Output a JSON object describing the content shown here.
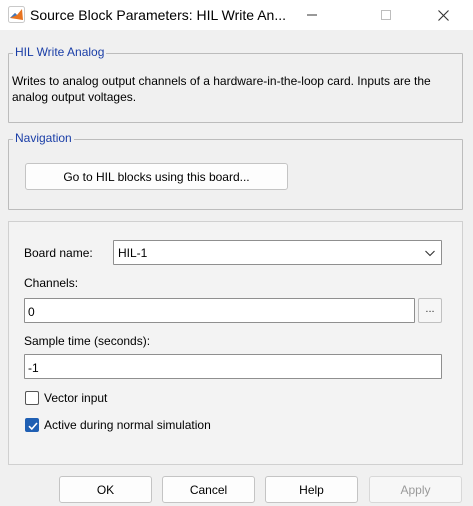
{
  "window": {
    "title": "Source Block Parameters: HIL Write An...",
    "controls": {
      "minimize": "−",
      "maximize": "☐",
      "close": "✕"
    }
  },
  "description_group": {
    "label": "HIL Write Analog",
    "text": "Writes to analog output channels of a hardware-in-the-loop card. Inputs are the analog output voltages."
  },
  "navigation_group": {
    "label": "Navigation",
    "button_label": "Go to HIL blocks using this board..."
  },
  "parameters": {
    "board_name_label": "Board name:",
    "board_name_value": "HIL-1",
    "channels_label": "Channels:",
    "channels_value": "0",
    "channels_browse": "...",
    "sample_time_label": "Sample time (seconds):",
    "sample_time_value": "-1",
    "vector_input_label": "Vector input",
    "vector_input_checked": false,
    "active_label": "Active during normal simulation",
    "active_checked": true
  },
  "footer": {
    "ok": "OK",
    "cancel": "Cancel",
    "help": "Help",
    "apply": "Apply"
  },
  "colors": {
    "group_label": "#1a3ea7",
    "checkbox_checked": "#1f5fb3"
  }
}
